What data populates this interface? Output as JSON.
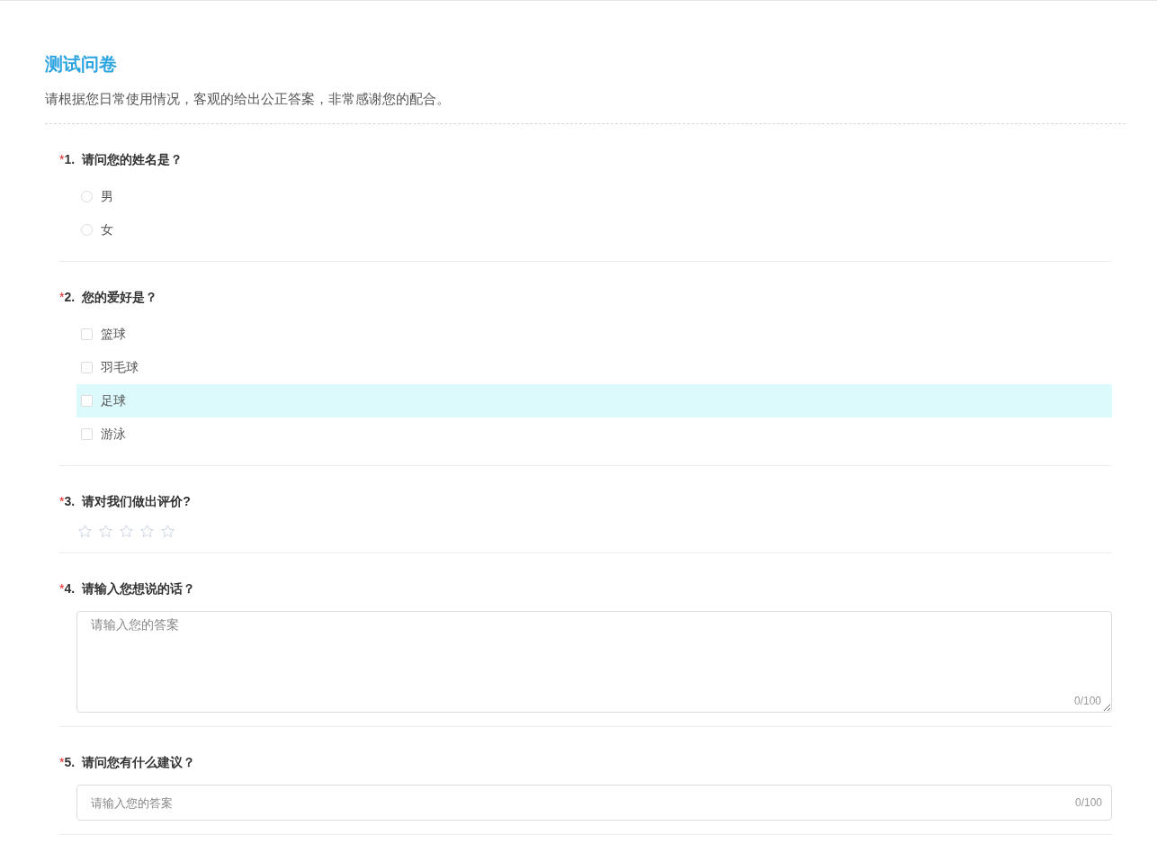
{
  "survey": {
    "title": "测试问卷",
    "description": "请根据您日常使用情况，客观的给出公正答案，非常感谢您的配合。"
  },
  "questions": [
    {
      "kind": "radio",
      "required": true,
      "required_mark": "*",
      "number": "1.",
      "title": "请问您的姓名是？",
      "options": [
        {
          "label": "男",
          "selected": false,
          "highlighted": false
        },
        {
          "label": "女",
          "selected": false,
          "highlighted": false
        }
      ]
    },
    {
      "kind": "checkbox",
      "required": true,
      "required_mark": "*",
      "number": "2.",
      "title": "您的爱好是？",
      "options": [
        {
          "label": "篮球",
          "checked": false,
          "highlighted": false
        },
        {
          "label": "羽毛球",
          "checked": false,
          "highlighted": false
        },
        {
          "label": "足球",
          "checked": false,
          "highlighted": true
        },
        {
          "label": "游泳",
          "checked": false,
          "highlighted": false
        }
      ]
    },
    {
      "kind": "rating",
      "required": true,
      "required_mark": "*",
      "number": "3.",
      "title": "请对我们做出评价?",
      "stars": 0
    },
    {
      "kind": "textarea",
      "required": true,
      "required_mark": "*",
      "number": "4.",
      "title": "请输入您想说的话？",
      "placeholder": "请输入您的答案",
      "counter": "0/100"
    },
    {
      "kind": "input",
      "required": true,
      "required_mark": "*",
      "number": "5.",
      "title": "请问您有什么建议？",
      "placeholder": "请输入您的答案",
      "counter": "0/100"
    }
  ]
}
